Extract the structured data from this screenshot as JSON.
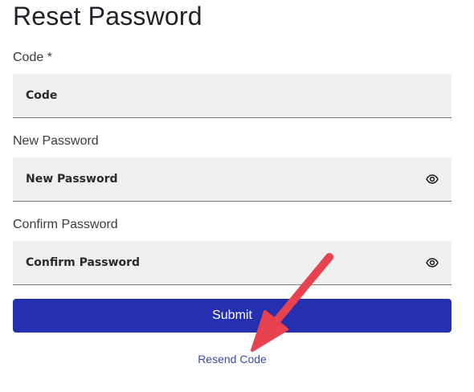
{
  "page": {
    "title": "Reset Password"
  },
  "form": {
    "code": {
      "label": "Code *",
      "placeholder": "Code"
    },
    "new_password": {
      "label": "New Password",
      "placeholder": "New Password"
    },
    "confirm_password": {
      "label": "Confirm Password",
      "placeholder": "Confirm Password"
    },
    "submit_label": "Submit",
    "resend_label": "Resend Code"
  },
  "icons": {
    "visibility_toggle": "eye-icon",
    "annotation": "red-arrow"
  },
  "colors": {
    "primary_button": "#2430b0",
    "link": "#3a4aa0",
    "field_background": "#efefef",
    "annotation_arrow": "#e8414f"
  }
}
